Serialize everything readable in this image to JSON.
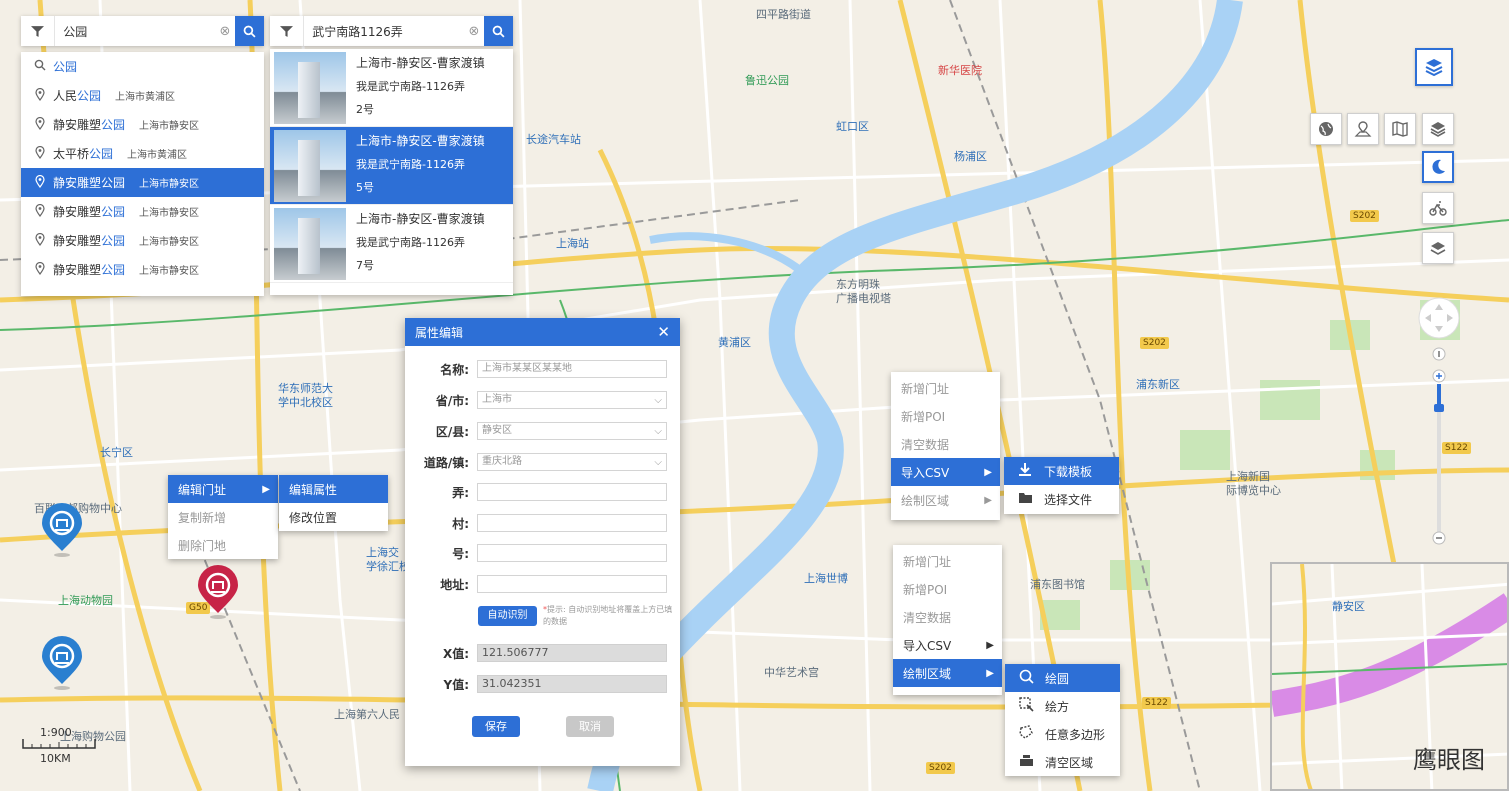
{
  "search_left": {
    "query": "公园",
    "suggestions": [
      {
        "prefix": "",
        "keyword": "公园",
        "suffix": "",
        "area": "",
        "icon": "search-icon"
      },
      {
        "prefix": "人民",
        "keyword": "公园",
        "suffix": "",
        "area": "上海市黄浦区",
        "icon": "location-pin-icon"
      },
      {
        "prefix": "静安雕塑",
        "keyword": "公园",
        "suffix": "",
        "area": "上海市静安区",
        "icon": "location-pin-icon"
      },
      {
        "prefix": "太平桥",
        "keyword": "公园",
        "suffix": "",
        "area": "上海市黄浦区",
        "icon": "location-pin-icon"
      },
      {
        "prefix": "静安雕塑",
        "keyword": "公园",
        "suffix": "",
        "area": "上海市静安区",
        "icon": "location-pin-icon",
        "active": true
      },
      {
        "prefix": "静安雕塑",
        "keyword": "公园",
        "suffix": "",
        "area": "上海市静安区",
        "icon": "location-pin-icon"
      },
      {
        "prefix": "静安雕塑",
        "keyword": "公园",
        "suffix": "",
        "area": "上海市静安区",
        "icon": "location-pin-icon"
      },
      {
        "prefix": "静安雕塑",
        "keyword": "公园",
        "suffix": "",
        "area": "上海市静安区",
        "icon": "location-pin-icon"
      }
    ]
  },
  "search_right": {
    "query": "武宁南路1126弄",
    "results": [
      {
        "title": "上海市-静安区-曹家渡镇",
        "street": "我是武宁南路-1126弄",
        "number": "2号"
      },
      {
        "title": "上海市-静安区-曹家渡镇",
        "street": "我是武宁南路-1126弄",
        "number": "5号",
        "active": true
      },
      {
        "title": "上海市-静安区-曹家渡镇",
        "street": "我是武宁南路-1126弄",
        "number": "7号"
      }
    ]
  },
  "dialog": {
    "title": "属性编辑",
    "fields": {
      "name": {
        "label": "名称:",
        "placeholder": "上海市某某区某某地"
      },
      "province": {
        "label": "省/市:",
        "value": "上海市"
      },
      "district": {
        "label": "区/县:",
        "value": "静安区"
      },
      "road": {
        "label": "道路/镇:",
        "value": "重庆北路"
      },
      "lane": {
        "label": "弄:"
      },
      "village": {
        "label": "村:"
      },
      "number": {
        "label": "号:"
      },
      "address": {
        "label": "地址:"
      },
      "x": {
        "label": "X值:",
        "value": "121.506777"
      },
      "y": {
        "label": "Y值:",
        "value": "31.042351"
      }
    },
    "auto_button": "自动识别",
    "hint_star": "*",
    "hint": "提示: 自动识别地址将覆盖上方已填的数据",
    "save": "保存",
    "cancel": "取消"
  },
  "menu_address": {
    "items": [
      {
        "label": "编辑门址",
        "active": true,
        "submenu": true
      },
      {
        "label": "复制新增",
        "disabled": true
      },
      {
        "label": "删除门地",
        "disabled": true
      }
    ],
    "submenu": [
      {
        "label": "编辑属性",
        "active": true
      },
      {
        "label": "修改位置"
      }
    ]
  },
  "menu_csv": {
    "items": [
      {
        "label": "新增门址",
        "disabled": true
      },
      {
        "label": "新增POI",
        "disabled": true
      },
      {
        "label": "清空数据",
        "disabled": true
      },
      {
        "label": "导入CSV",
        "active": true,
        "submenu": true
      },
      {
        "label": "绘制区域",
        "disabled": true,
        "submenu": true
      }
    ],
    "submenu": [
      {
        "label": "下载模板",
        "icon": "download-icon",
        "active": true
      },
      {
        "label": "选择文件",
        "icon": "folder-icon"
      }
    ]
  },
  "menu_draw": {
    "items": [
      {
        "label": "新增门址",
        "disabled": true
      },
      {
        "label": "新增POI",
        "disabled": true
      },
      {
        "label": "清空数据",
        "disabled": true
      },
      {
        "label": "导入CSV",
        "submenu": true
      },
      {
        "label": "绘制区域",
        "active": true,
        "submenu": true
      }
    ],
    "submenu": [
      {
        "label": "绘圆",
        "icon": "draw-circle-icon",
        "active": true
      },
      {
        "label": "绘方",
        "icon": "draw-rectangle-icon"
      },
      {
        "label": "任意多边形",
        "icon": "draw-polygon-icon"
      },
      {
        "label": "清空区域",
        "icon": "clear-area-icon"
      }
    ]
  },
  "map_labels": [
    {
      "text": "四平路街道",
      "cls": ""
    },
    {
      "text": "鲁迅公园",
      "cls": "green"
    },
    {
      "text": "新华医院",
      "cls": "red"
    },
    {
      "text": "长途汽车站",
      "cls": "blue"
    },
    {
      "text": "虹口区",
      "cls": "blue"
    },
    {
      "text": "杨浦区",
      "cls": "blue"
    },
    {
      "text": "上海站",
      "cls": "blue"
    },
    {
      "text": "东方明珠",
      "cls": ""
    },
    {
      "text": "广播电视塔",
      "cls": ""
    },
    {
      "text": "黄浦区",
      "cls": "blue"
    },
    {
      "text": "浦东新区",
      "cls": "blue"
    },
    {
      "text": "华东师范大",
      "cls": "blue"
    },
    {
      "text": "学中北校区",
      "cls": "blue"
    },
    {
      "text": "长宁区",
      "cls": "blue"
    },
    {
      "text": "上海动物园",
      "cls": "green"
    },
    {
      "text": "上海交",
      "cls": "blue"
    },
    {
      "text": "学徐汇校区",
      "cls": "blue"
    },
    {
      "text": "上海世博",
      "cls": "blue"
    },
    {
      "text": "浦东图书馆",
      "cls": ""
    },
    {
      "text": "中华艺术宫",
      "cls": ""
    },
    {
      "text": "上海新国",
      "cls": ""
    },
    {
      "text": "际博览中心",
      "cls": ""
    },
    {
      "text": "上海第六人民",
      "cls": ""
    },
    {
      "text": "上海购物公园",
      "cls": ""
    },
    {
      "text": "百联西郊购物中心",
      "cls": ""
    }
  ],
  "road_badges": [
    "S202",
    "S202",
    "S122",
    "S122",
    "S202",
    "G50"
  ],
  "scale": {
    "ratio": "1:900",
    "unit": "10KM"
  },
  "eagle_eye": {
    "title": "鹰眼图",
    "label": "静安区"
  },
  "colors": {
    "accent": "#2d6fd6",
    "road_major": "#f2c94c",
    "river": "#a9d2f5",
    "pin_blue": "#2a7fd0",
    "pin_red": "#c72447"
  }
}
